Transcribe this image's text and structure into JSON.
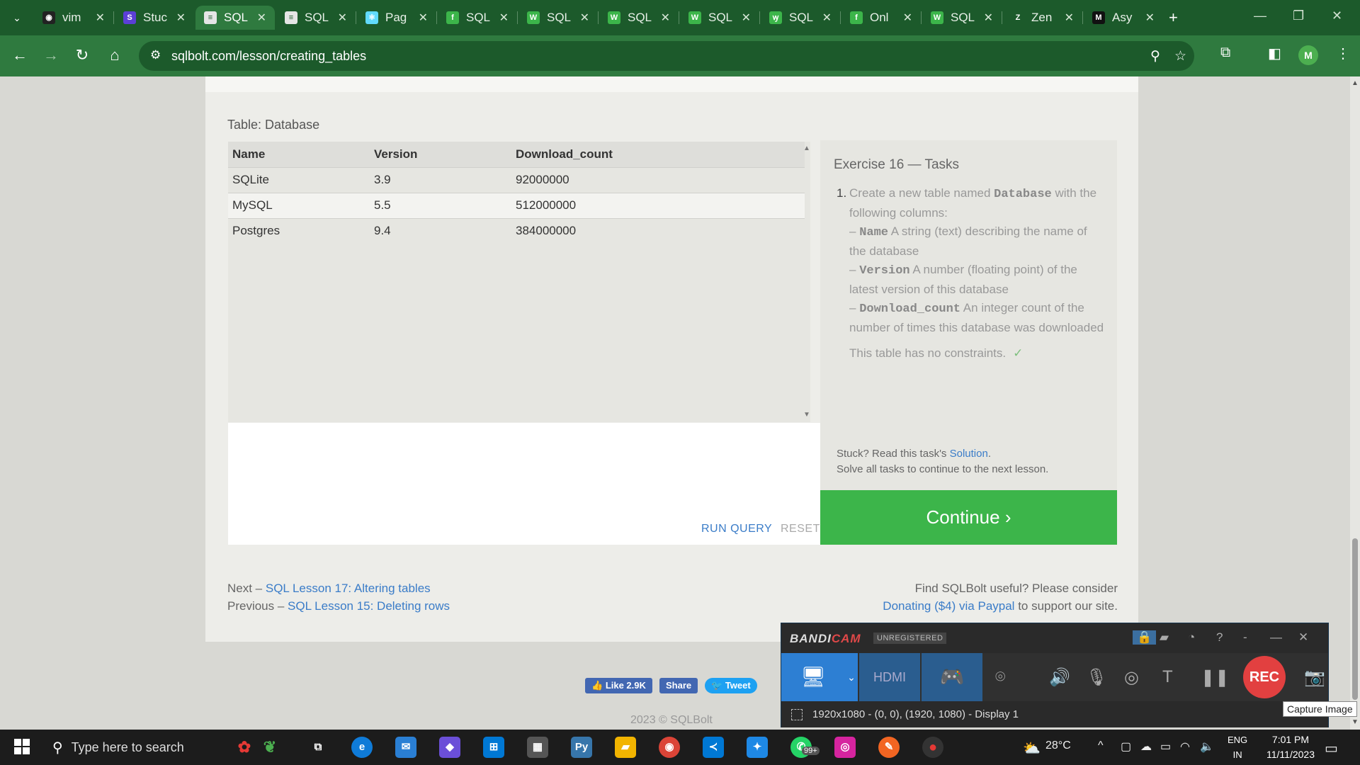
{
  "browser": {
    "tabs": [
      {
        "label": "vim",
        "favicon": "github",
        "color": "#222222"
      },
      {
        "label": "Stuc",
        "favicon": "studocu",
        "color": "#5b3fd6"
      },
      {
        "label": "SQL",
        "favicon": "database",
        "color": "#e5e5e5",
        "active": true
      },
      {
        "label": "SQL",
        "favicon": "database",
        "color": "#e5e5e5"
      },
      {
        "label": "Pag",
        "favicon": "react",
        "color": "#61dafb"
      },
      {
        "label": "SQL",
        "favicon": "f-green",
        "color": "#3cb54a"
      },
      {
        "label": "SQL",
        "favicon": "w-green",
        "color": "#3cb54a"
      },
      {
        "label": "SQL",
        "favicon": "w-green",
        "color": "#3cb54a"
      },
      {
        "label": "SQL",
        "favicon": "w-green",
        "color": "#3cb54a"
      },
      {
        "label": "SQL",
        "favicon": "leaf-green",
        "color": "#3cb54a"
      },
      {
        "label": "Onl",
        "favicon": "f-green",
        "color": "#3cb54a"
      },
      {
        "label": "SQL",
        "favicon": "w-green",
        "color": "#3cb54a"
      },
      {
        "label": "Zen",
        "favicon": "zen",
        "color": "#1c5a2b"
      },
      {
        "label": "Asy",
        "favicon": "medium",
        "color": "#111111"
      }
    ],
    "url": "sqlbolt.com/lesson/creating_tables",
    "profile_initial": "M"
  },
  "lesson": {
    "table_caption": "Table: Database",
    "columns": [
      "Name",
      "Version",
      "Download_count"
    ],
    "rows": [
      [
        "SQLite",
        "3.9",
        "92000000"
      ],
      [
        "MySQL",
        "5.5",
        "512000000"
      ],
      [
        "Postgres",
        "9.4",
        "384000000"
      ]
    ],
    "run_query": "RUN QUERY",
    "reset": "RESET",
    "tasks_title": "Exercise 16 — Tasks",
    "task_number": "1.",
    "task": {
      "intro_a": "Create a new table named ",
      "intro_code": "Database",
      "intro_b": " with the following columns:",
      "col1_dash": "– ",
      "col1_code": "Name",
      "col1_text": " A string (text) describing the name of the database",
      "col2_dash": "– ",
      "col2_code": "Version",
      "col2_text": " A number (floating point) of the latest version of this database",
      "col3_dash": "– ",
      "col3_code": "Download_count",
      "col3_text": " An integer count of the number of times this database was downloaded",
      "note": "This table has no constraints.",
      "check": "✓"
    },
    "stuck_a": "Stuck? Read this task's ",
    "stuck_link": "Solution",
    "stuck_b": ".",
    "solve_all": "Solve all tasks to continue to the next lesson.",
    "continue": "Continue ›"
  },
  "footer": {
    "next_prefix": "Next – ",
    "next_link": "SQL Lesson 17: Altering tables",
    "prev_prefix": "Previous – ",
    "prev_link": "SQL Lesson 15: Deleting rows",
    "support_a": "Find SQLBolt useful? Please consider",
    "support_link": "Donating ($4) via Paypal",
    "support_b": " to support our site.",
    "like": "Like 2.9K",
    "share": "Share",
    "tweet": "Tweet",
    "copyright": "2023 © SQLBolt"
  },
  "bandicam": {
    "logo_a": "BANDI",
    "logo_b": "CAM",
    "unregistered": "UNREGISTERED",
    "rec": "REC",
    "status": "1920x1080 - (0, 0), (1920, 1080) - Display 1",
    "tooltip": "Capture Image"
  },
  "taskbar": {
    "search_placeholder": "Type here to search",
    "weather": "28°C",
    "lang_a": "ENG",
    "lang_b": "IN",
    "time": "7:01 PM",
    "date": "11/11/2023",
    "whatsapp_badge": "99+"
  }
}
